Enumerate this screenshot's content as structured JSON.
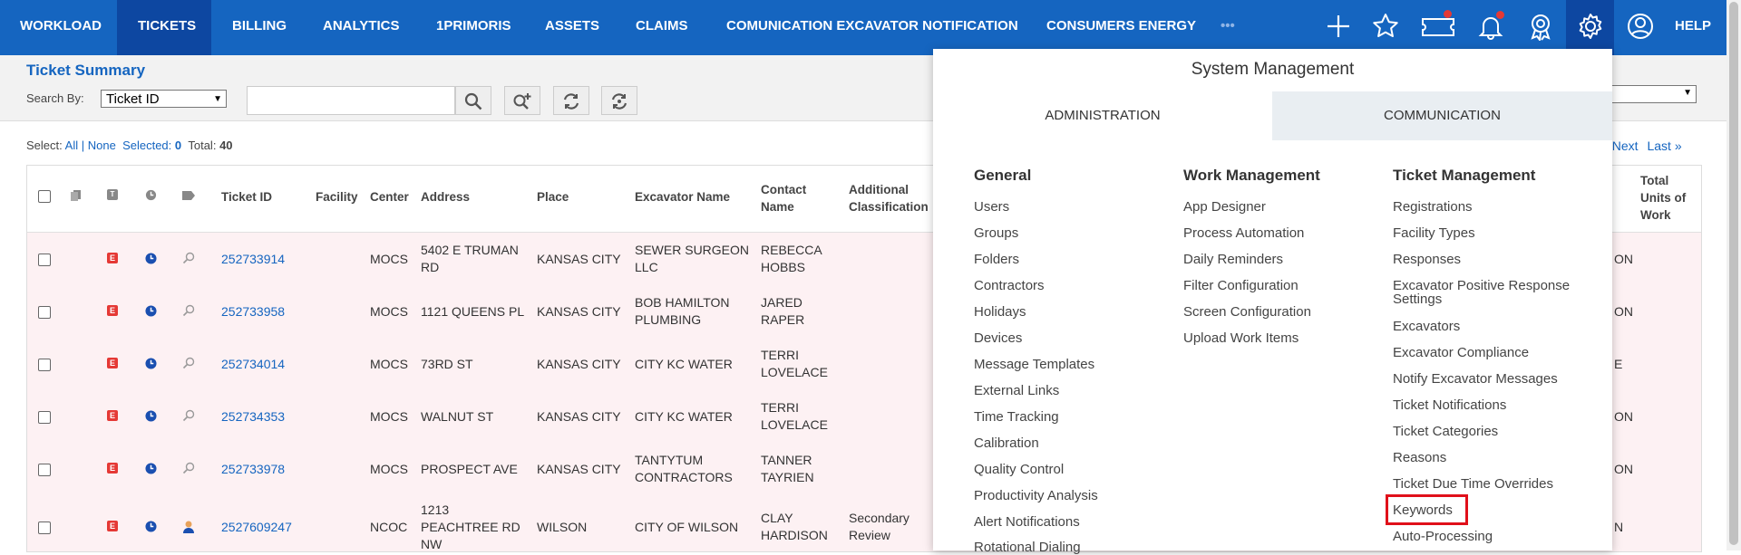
{
  "nav": {
    "items": [
      "WORKLOAD",
      "TICKETS",
      "BILLING",
      "ANALYTICS",
      "1PRIMORIS",
      "ASSETS",
      "CLAIMS",
      "COMUNICATION EXCAVATOR NOTIFICATION",
      "CONSUMERS ENERGY"
    ],
    "more": "•••",
    "help": "HELP"
  },
  "summary": {
    "title": "Ticket Summary",
    "search_by_label": "Search By:",
    "search_by_value": "Ticket ID",
    "select_label": "Select:",
    "all": "All",
    "sep": "|",
    "none": "None",
    "selected_label": "Selected:",
    "selected_value": "0",
    "total_label": "Total:",
    "total_value": "40",
    "pager_partial": "t",
    "next": "Next",
    "last": "Last »"
  },
  "table": {
    "headers": [
      "Ticket ID",
      "Facility",
      "Center",
      "Address",
      "Place",
      "Excavator Name",
      "Contact Name",
      "Additional Classification",
      "Total Units of Work"
    ],
    "rows": [
      {
        "ticket": "252733914",
        "center": "MOCS",
        "address": "5402 E TRUMAN RD",
        "place": "KANSAS CITY",
        "excavator": "SEWER SURGEON LLC",
        "contact": "REBECCA HOBBS",
        "classification": "",
        "tail": "ON"
      },
      {
        "ticket": "252733958",
        "center": "MOCS",
        "address": "1121 QUEENS PL",
        "place": "KANSAS CITY",
        "excavator": "BOB HAMILTON PLUMBING",
        "contact": "JARED RAPER",
        "classification": "",
        "tail": "ON"
      },
      {
        "ticket": "252734014",
        "center": "MOCS",
        "address": "73RD ST",
        "place": "KANSAS CITY",
        "excavator": "CITY KC WATER",
        "contact": "TERRI LOVELACE",
        "classification": "",
        "tail": "E"
      },
      {
        "ticket": "252734353",
        "center": "MOCS",
        "address": "WALNUT ST",
        "place": "KANSAS CITY",
        "excavator": "CITY KC WATER",
        "contact": "TERRI LOVELACE",
        "classification": "",
        "tail": "ON"
      },
      {
        "ticket": "252733978",
        "center": "MOCS",
        "address": "PROSPECT AVE",
        "place": "KANSAS CITY",
        "excavator": "TANTYTUM CONTRACTORS",
        "contact": "TANNER TAYRIEN",
        "classification": "",
        "tail": "ON"
      },
      {
        "ticket": "2527609247",
        "center": "NCOC",
        "address": "1213 PEACHTREE RD NW",
        "place": "WILSON",
        "excavator": "CITY OF WILSON",
        "contact": "CLAY HARDISON",
        "classification": "Secondary Review",
        "tail": "N"
      }
    ],
    "e_badge": "E"
  },
  "panel": {
    "title": "System Management",
    "tabs": [
      "ADMINISTRATION",
      "COMMUNICATION"
    ],
    "general": {
      "heading": "General",
      "items": [
        "Users",
        "Groups",
        "Folders",
        "Contractors",
        "Holidays",
        "Devices",
        "Message Templates",
        "External Links",
        "Time Tracking",
        "Calibration",
        "Quality Control",
        "Productivity Analysis",
        "Alert Notifications",
        "Rotational Dialing"
      ]
    },
    "work": {
      "heading": "Work Management",
      "items": [
        "App Designer",
        "Process Automation",
        "Daily Reminders",
        "Filter Configuration",
        "Screen Configuration",
        "Upload Work Items"
      ]
    },
    "ticket": {
      "heading": "Ticket Management",
      "items": [
        "Registrations",
        "Facility Types",
        "Responses",
        "Excavator Positive Response Settings",
        "Excavators",
        "Excavator Compliance",
        "Notify Excavator Messages",
        "Ticket Notifications",
        "Ticket Categories",
        "Reasons",
        "Ticket Due Time Overrides",
        "Keywords",
        "Auto-Processing"
      ]
    }
  },
  "colors": {
    "nav_bg": "#1565c0",
    "nav_active": "#0d47a1",
    "link": "#1565c0",
    "row_bg": "#fdf1f3",
    "highlight": "#e0101a"
  },
  "icons": [
    "plus-icon",
    "star-icon",
    "ticket-notify-icon",
    "bell-icon",
    "award-icon",
    "gear-icon",
    "user-circle-icon",
    "search-icon",
    "zoom-plus-icon",
    "refresh-icon",
    "reset-icon",
    "clock-icon",
    "magnifier-icon",
    "agent-icon"
  ]
}
